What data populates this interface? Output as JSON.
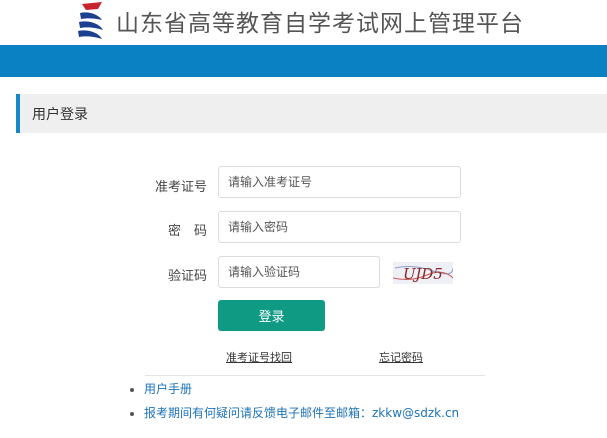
{
  "header": {
    "site_title": "山东省高等教育自学考试网上管理平台"
  },
  "panel": {
    "title": "用户登录"
  },
  "form": {
    "exam_id": {
      "label": "准考证号",
      "placeholder": "请输入准考证号"
    },
    "password": {
      "label": "密　码",
      "placeholder": "请输入密码"
    },
    "captcha": {
      "label": "验证码",
      "placeholder": "请输入验证码",
      "image_text": "UJD5"
    },
    "login_label": "登录"
  },
  "links": {
    "recover_id": "准考证号找回",
    "forgot_password": "忘记密码"
  },
  "notes": [
    "用户手册",
    "报考期间有何疑问请反馈电子邮件至邮箱：zkkw@sdzk.cn"
  ],
  "colors": {
    "band": "#0a81c2",
    "accent": "#1688c8",
    "button": "#0f9a84",
    "link": "#1e73b8"
  }
}
